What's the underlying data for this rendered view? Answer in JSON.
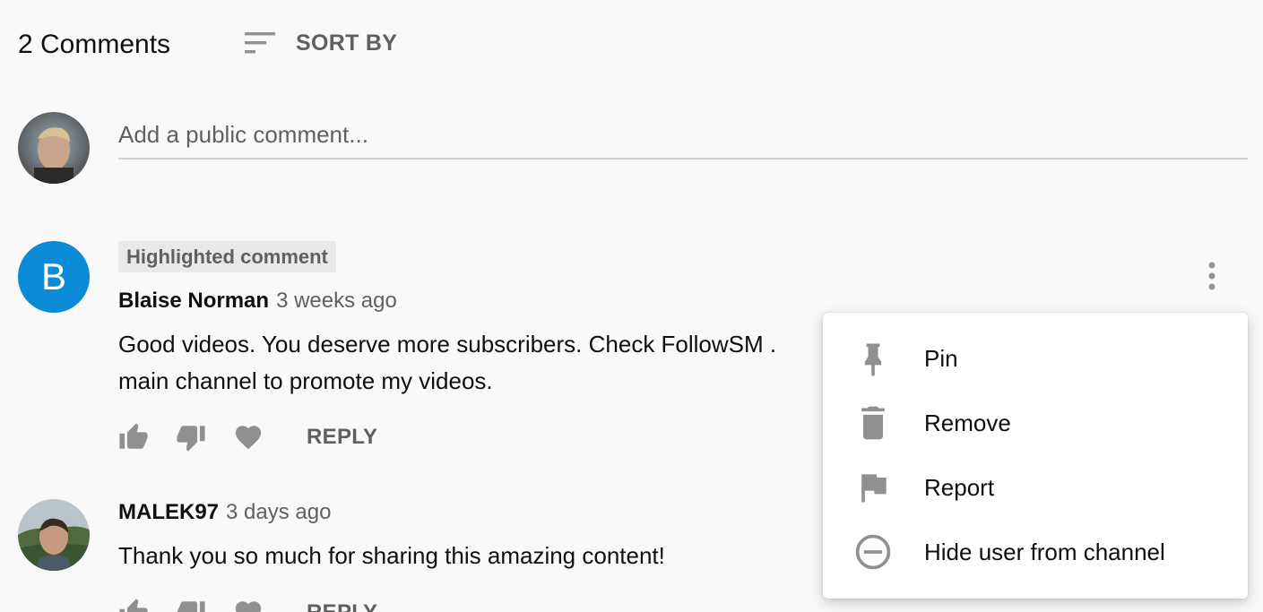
{
  "header": {
    "comments_count": "2 Comments",
    "sort_label": "SORT BY"
  },
  "add_comment": {
    "placeholder": "Add a public comment..."
  },
  "comments": [
    {
      "badge": "Highlighted comment",
      "avatar_letter": "B",
      "author": "Blaise Norman",
      "time": "3 weeks ago",
      "text_line1": "Good videos. You deserve more subscribers.  Check FollowSM .",
      "text_line2": "main channel to promote my videos.",
      "reply": "REPLY"
    },
    {
      "author": "MALEK97",
      "time": "3 days ago",
      "text_line1": "Thank you so much for sharing this amazing content!",
      "reply": "REPLY"
    }
  ],
  "menu": {
    "items": [
      {
        "label": "Pin",
        "icon": "pin-icon"
      },
      {
        "label": "Remove",
        "icon": "trash-icon"
      },
      {
        "label": "Report",
        "icon": "flag-icon"
      },
      {
        "label": "Hide user from channel",
        "icon": "block-icon"
      }
    ]
  },
  "colors": {
    "background": "#f9f9f9",
    "avatar_b": "#0b8bd6",
    "secondary_text": "#606060",
    "icon_gray": "#909090"
  }
}
